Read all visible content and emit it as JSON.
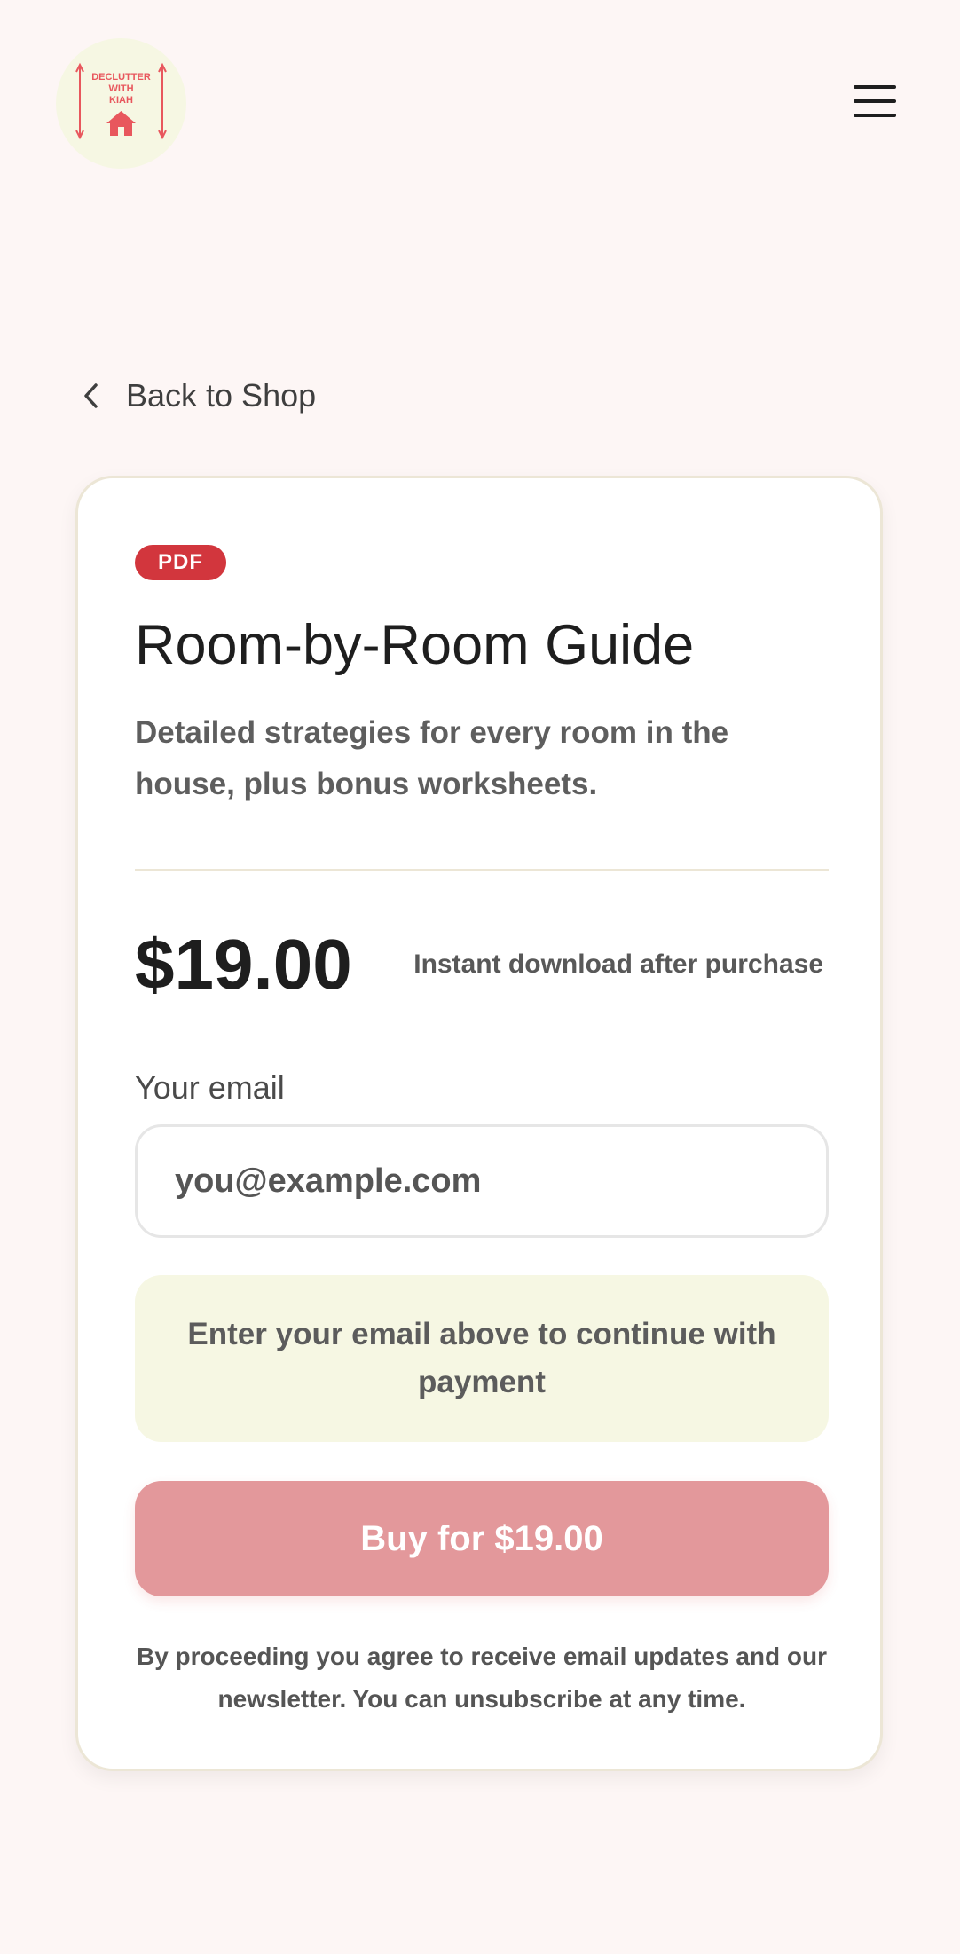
{
  "header": {
    "logo_lines": [
      "DECLUTTER",
      "WITH",
      "KIAH"
    ],
    "menu_icon": "hamburger-menu-icon"
  },
  "nav": {
    "back_label": "Back to Shop",
    "back_icon": "chevron-left-icon"
  },
  "product": {
    "badge": "PDF",
    "title": "Room-by-Room Guide",
    "description": "Detailed strategies for every room in the house, plus bonus worksheets.",
    "price": "$19.00",
    "delivery_note": "Instant download after purchase"
  },
  "checkout": {
    "email_label": "Your email",
    "email_placeholder": "you@example.com",
    "email_value": "",
    "notice": "Enter your email above to continue with payment",
    "buy_label": "Buy for $19.00",
    "terms": "By proceeding you agree to receive email updates and our newsletter. You can unsubscribe at any time."
  },
  "colors": {
    "page_background": "#fdf6f5",
    "accent_red": "#d2363d",
    "button_disabled": "#e3989b",
    "notice_background": "#f6f7e3",
    "logo_pink": "#e8575d"
  }
}
